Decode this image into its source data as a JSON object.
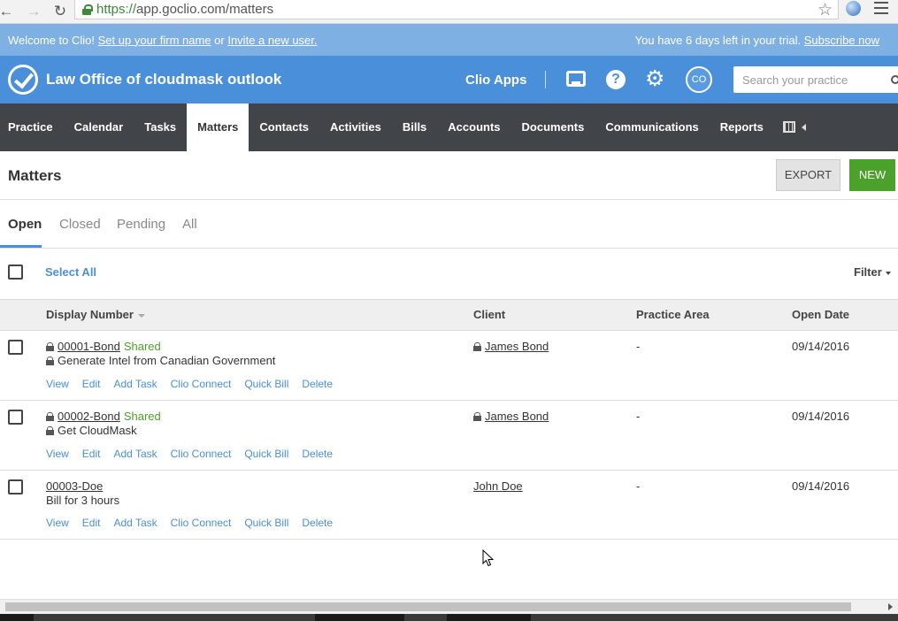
{
  "browser": {
    "url_scheme": "https://",
    "url_rest": "app.goclio.com/matters"
  },
  "trial_bar": {
    "welcome": "Welcome to Clio!",
    "setup_link": "Set up your firm name",
    "or_text": "or",
    "invite_link": "Invite a new user.",
    "trial_text": "You have 6 days left in your trial.",
    "subscribe_link": "Subscribe now"
  },
  "header": {
    "firm_name": "Law Office of cloudmask outlook",
    "clio_apps": "Clio Apps",
    "help_glyph": "?",
    "gear_glyph": "⚙",
    "avatar_initials": "CO",
    "search_placeholder": "Search your practice"
  },
  "nav": {
    "items": [
      "Practice",
      "Calendar",
      "Tasks",
      "Matters",
      "Contacts",
      "Activities",
      "Bills",
      "Accounts",
      "Documents",
      "Communications",
      "Reports"
    ],
    "active": "Matters"
  },
  "page": {
    "title": "Matters",
    "export_label": "EXPORT",
    "new_label": "NEW"
  },
  "tabs": {
    "open": "Open",
    "closed": "Closed",
    "pending": "Pending",
    "all": "All"
  },
  "selectbar": {
    "select_all": "Select All",
    "filter": "Filter"
  },
  "table": {
    "columns": {
      "display_number": "Display Number",
      "client": "Client",
      "practice_area": "Practice Area",
      "open_date": "Open Date"
    },
    "actions": [
      "View",
      "Edit",
      "Add Task",
      "Clio Connect",
      "Quick Bill",
      "Delete"
    ],
    "rows": [
      {
        "number": "00001-Bond",
        "shared": "Shared",
        "description": "Generate Intel from Canadian Government",
        "client": "James Bond",
        "practice_area": "-",
        "open_date": "09/14/2016"
      },
      {
        "number": "00002-Bond",
        "shared": "Shared",
        "description": "Get CloudMask",
        "client": "James Bond",
        "practice_area": "-",
        "open_date": "09/14/2016"
      },
      {
        "number": "00003-Doe",
        "shared": "",
        "description": "Bill for 3 hours",
        "client": "John Doe",
        "practice_area": "-",
        "open_date": "09/14/2016"
      }
    ]
  },
  "colors": {
    "header_blue": "#4a8fd9",
    "trial_blue": "#7fb0e3",
    "nav_dark": "#414549",
    "new_green": "#4ca12a",
    "shared_green": "#4ca12a"
  },
  "icons": [
    "back-arrow-icon",
    "forward-arrow-icon",
    "reload-icon",
    "lock-icon",
    "star-icon",
    "extension-icon",
    "menu-icon",
    "clio-logo-icon",
    "inbox-icon",
    "help-icon",
    "gear-icon",
    "search-icon",
    "calendar-icon",
    "caret-left-icon",
    "sort-icon",
    "lock-icon",
    "cursor-icon"
  ]
}
